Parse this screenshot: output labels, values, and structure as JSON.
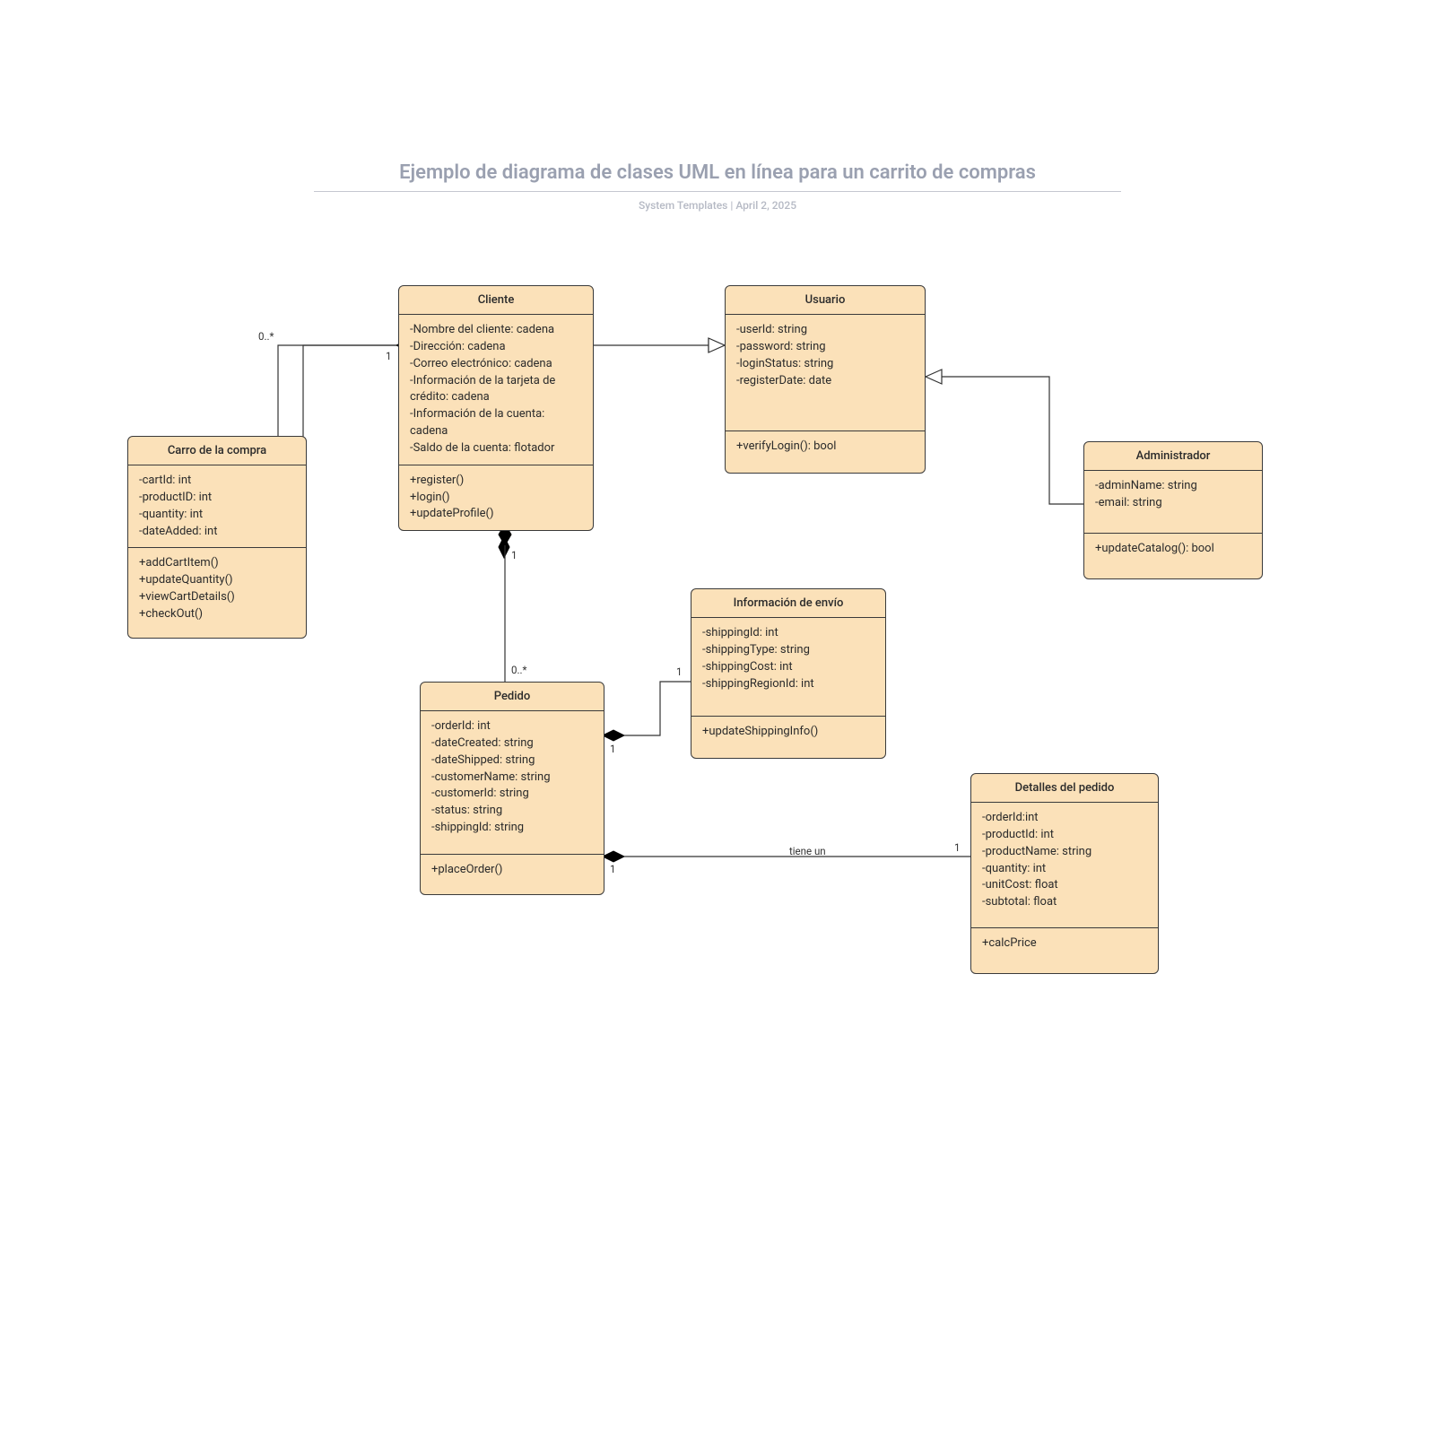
{
  "title": "Ejemplo de diagrama de clases UML en línea para un carrito de compras",
  "subtitle_author": "System Templates",
  "subtitle_sep": "  |  ",
  "subtitle_date": "April 2, 2025",
  "classes": {
    "cart": {
      "name": "Carro de la compra",
      "attrs": "-cartId: int\n-productID: int\n-quantity: int\n-dateAdded: int",
      "methods": "+addCartItem()\n+updateQuantity()\n+viewCartDetails()\n+checkOut()"
    },
    "cliente": {
      "name": "Cliente",
      "attrs": "-Nombre del cliente: cadena\n-Dirección: cadena\n-Correo electrónico: cadena\n-Información de la tarjeta de crédito: cadena\n-Información de la cuenta: cadena\n-Saldo de la cuenta: flotador",
      "methods": "+register()\n+login()\n+updateProfile()"
    },
    "usuario": {
      "name": "Usuario",
      "attrs": "-userId: string\n-password: string\n-loginStatus: string\n-registerDate: date",
      "methods": "+verifyLogin(): bool"
    },
    "admin": {
      "name": "Administrador",
      "attrs": "-adminName: string\n-email: string",
      "methods": "+updateCatalog(): bool"
    },
    "pedido": {
      "name": "Pedido",
      "attrs": "-orderId: int\n-dateCreated: string\n-dateShipped: string\n-customerName: string\n-customerId: string\n-status: string\n-shippingId: string",
      "methods": "+placeOrder()"
    },
    "shipping": {
      "name": "Información de envío",
      "attrs": "-shippingId: int\n-shippingType: string\n-shippingCost: int\n-shippingRegionId: int",
      "methods": "+updateShippingInfo()"
    },
    "detalle": {
      "name": "Detalles del pedido",
      "attrs": "-orderId:int\n-productId: int\n-productName: string\n-quantity: int\n-unitCost: float\n-subtotal: float",
      "methods": "+calcPrice"
    }
  },
  "labels": {
    "cart_mult": "0..*",
    "cliente_cart_side": "1",
    "cliente_pedido_side": "1",
    "pedido_mult": "0..*",
    "pedido_ship_side": "1",
    "ship_side": "1",
    "pedido_det_side": "1",
    "det_side": "1",
    "tiene_un": "tiene un"
  }
}
